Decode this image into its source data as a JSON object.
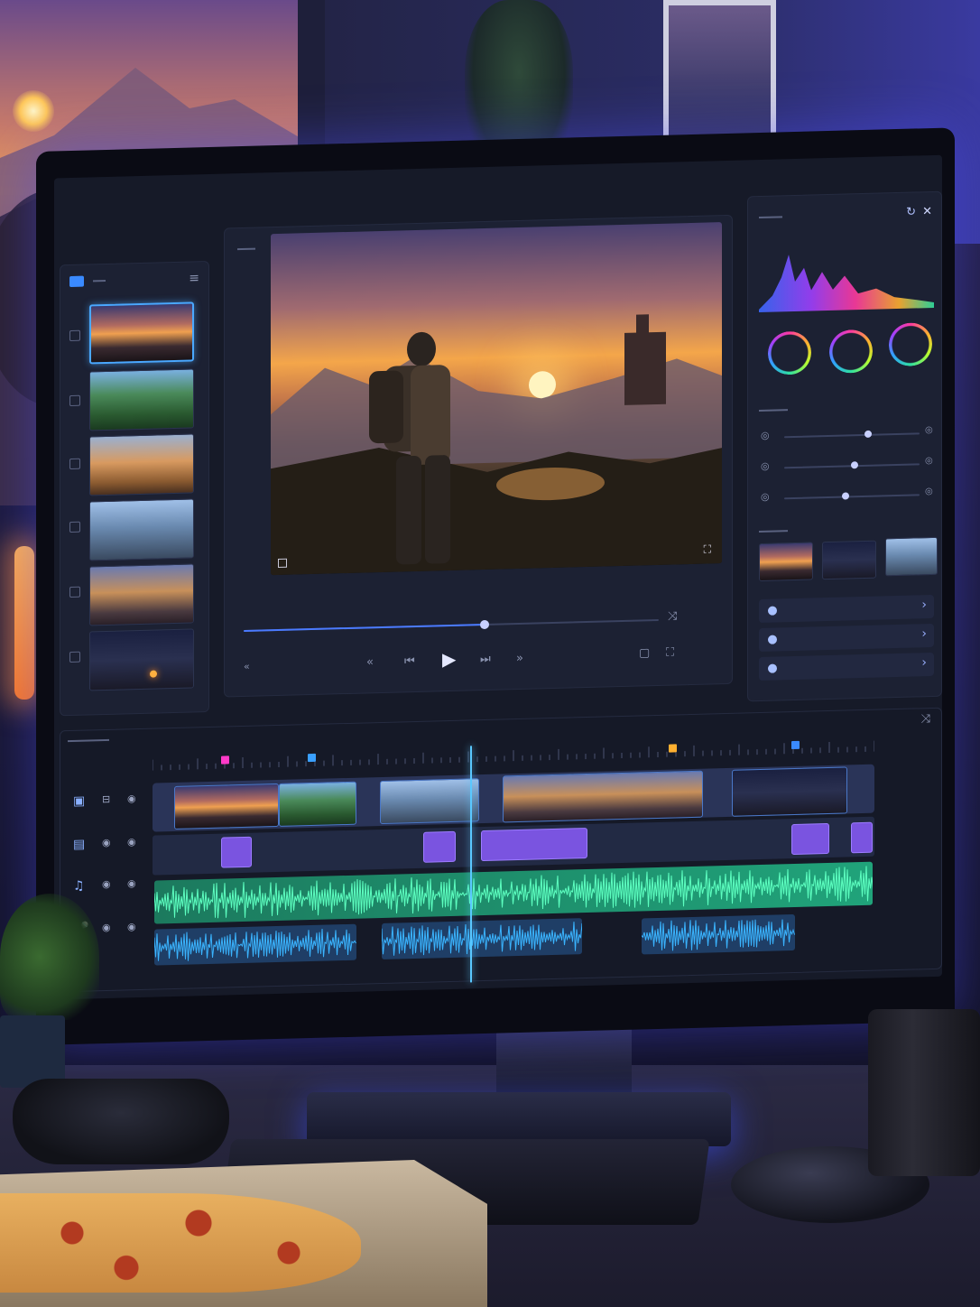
{
  "scene": {
    "caption": "",
    "colors": {
      "accent_blue": "#4aa8ff",
      "neon_orange": "#ff8a30",
      "ui_bg": "#161a28",
      "panel": "#1c2133"
    }
  },
  "editor": {
    "media_bin": {
      "items": [
        "sunset-hiker",
        "forest",
        "offroad-truck",
        "helicopter-soldier",
        "castle-dusk",
        "campfire-night"
      ],
      "selected_index": 0
    },
    "transport": {
      "progress": 0.58
    },
    "color_panel": {
      "sliders": [
        0.62,
        0.52,
        0.45
      ],
      "looks": [
        "sunset-look",
        "blue-mountain-look",
        "misty-mountain-look"
      ]
    },
    "timeline": {
      "playhead": 0.44,
      "markers": [
        {
          "pos": 0.1,
          "color": "#ff3ac8"
        },
        {
          "pos": 0.22,
          "color": "#3aa0ff"
        },
        {
          "pos": 0.72,
          "color": "#ffb030"
        },
        {
          "pos": 0.89,
          "color": "#3a8aff"
        }
      ],
      "tracks": [
        "video-track",
        "fx-track",
        "music-track",
        "voice-track"
      ]
    }
  },
  "icons": {
    "folder": "folder-icon",
    "menu": "menu-icon",
    "play": "▶",
    "prev": "⏮",
    "next": "⏭",
    "rewind": "«",
    "forward": "»",
    "chevron": "›",
    "close": "✕",
    "refresh": "↻",
    "music": "♫",
    "eye": "◉",
    "lock": "🔒"
  }
}
